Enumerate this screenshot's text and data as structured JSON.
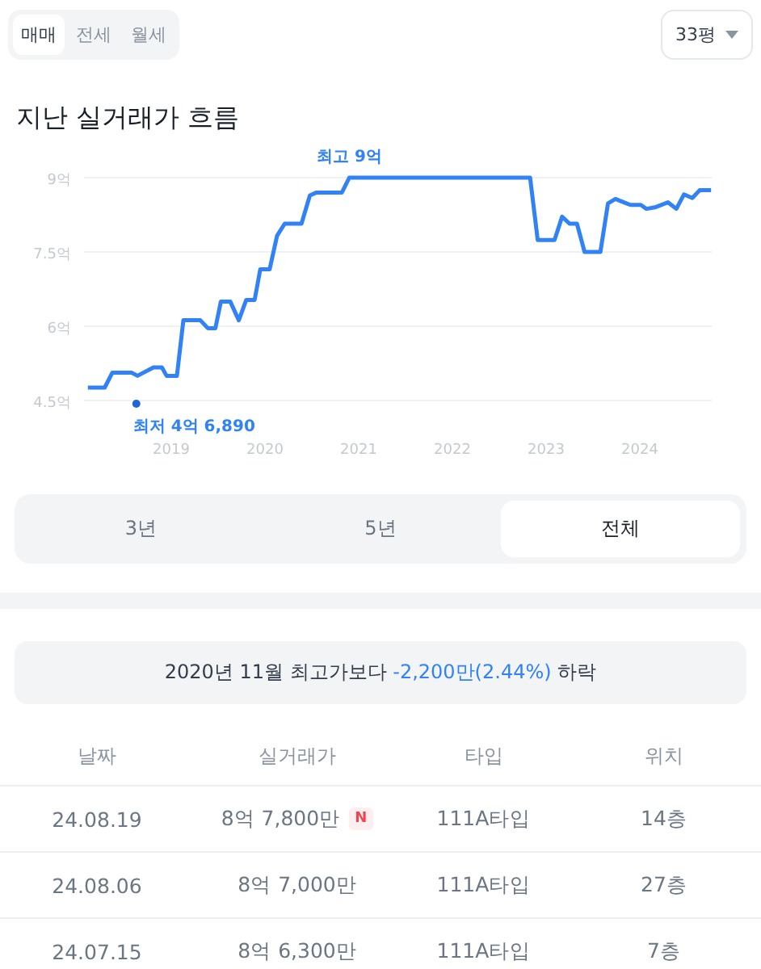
{
  "deal_tabs": [
    {
      "label": "매매",
      "selected": true
    },
    {
      "label": "전세",
      "selected": false
    },
    {
      "label": "월세",
      "selected": false
    }
  ],
  "size_dropdown": {
    "label": "33평"
  },
  "title": "지난 실거래가 흐름",
  "chart_data": {
    "type": "line",
    "xlim": [
      2018.07,
      2024.77
    ],
    "ylim": [
      4.5,
      9
    ],
    "yticks": [
      {
        "value": 4.5,
        "label": "4.5억"
      },
      {
        "value": 6,
        "label": "6억"
      },
      {
        "value": 7.5,
        "label": "7.5억"
      },
      {
        "value": 9,
        "label": "9억"
      }
    ],
    "xticks": [
      {
        "value": 2019,
        "label": "2019"
      },
      {
        "value": 2020,
        "label": "2020"
      },
      {
        "value": 2021,
        "label": "2021"
      },
      {
        "value": 2022,
        "label": "2022"
      },
      {
        "value": 2023,
        "label": "2023"
      },
      {
        "value": 2024,
        "label": "2024"
      }
    ],
    "x": [
      2018.11,
      2018.29,
      2018.37,
      2018.58,
      2018.64,
      2018.81,
      2018.9,
      2018.95,
      2019.06,
      2019.13,
      2019.31,
      2019.39,
      2019.47,
      2019.53,
      2019.63,
      2019.72,
      2019.8,
      2019.89,
      2019.95,
      2020.05,
      2020.13,
      2020.21,
      2020.39,
      2020.48,
      2020.55,
      2020.82,
      2020.9,
      2022.83,
      2022.91,
      2023.09,
      2023.17,
      2023.25,
      2023.33,
      2023.41,
      2023.58,
      2023.66,
      2023.74,
      2023.9,
      2024.01,
      2024.07,
      2024.16,
      2024.3,
      2024.39,
      2024.47,
      2024.56,
      2024.64,
      2024.76
    ],
    "series": [
      {
        "color": "#3182f6",
        "values": [
          4.76,
          4.76,
          5.06,
          5.06,
          5.0,
          5.17,
          5.17,
          5.0,
          5.0,
          6.12,
          6.12,
          5.96,
          5.96,
          6.5,
          6.5,
          6.12,
          6.53,
          6.53,
          7.15,
          7.15,
          7.83,
          8.07,
          8.07,
          8.64,
          8.7,
          8.7,
          9.0,
          9.0,
          7.74,
          7.74,
          8.21,
          8.07,
          8.07,
          7.5,
          7.5,
          8.48,
          8.57,
          8.45,
          8.45,
          8.37,
          8.4,
          8.5,
          8.37,
          8.66,
          8.59,
          8.75,
          8.75
        ]
      }
    ],
    "annotations": [
      {
        "text": "최고 9억",
        "x": 2020.9,
        "y": 9.0
      },
      "최저 4억 6,890"
    ]
  },
  "period_tabs": [
    {
      "label": "3년",
      "selected": false
    },
    {
      "label": "5년",
      "selected": false
    },
    {
      "label": "전체",
      "selected": true
    }
  ],
  "notice": {
    "before": "2020년 11월 최고가보다",
    "change": "-2,200만(2.44%)",
    "after": "하락"
  },
  "table": {
    "columns": [
      "날짜",
      "실거래가",
      "타입",
      "위치"
    ],
    "rows": [
      {
        "date": "24.08.19",
        "price": "8억 7,800만",
        "badge": "N",
        "type": "111A타입",
        "floor": "14층"
      },
      {
        "date": "24.08.06",
        "price": "8억 7,000만",
        "type": "111A타입",
        "floor": "27층"
      },
      {
        "date": "24.07.15",
        "price": "8억 6,300만",
        "type": "111A타입",
        "floor": "7층"
      }
    ]
  }
}
